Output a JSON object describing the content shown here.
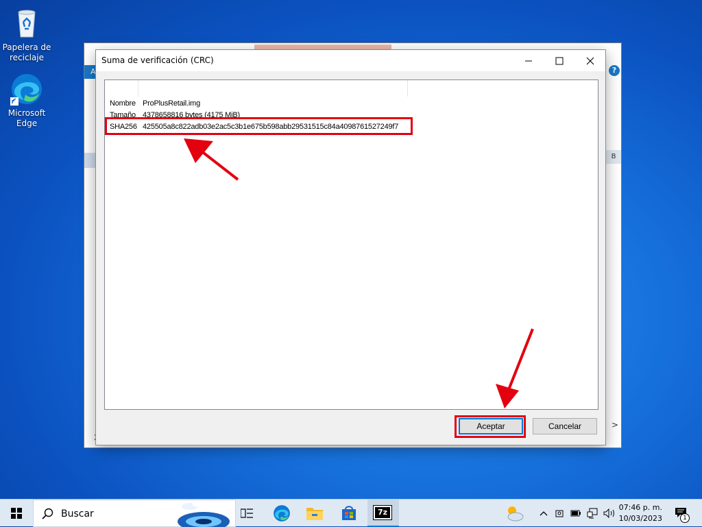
{
  "desktop": {
    "icons": [
      {
        "label": "Papelera de reciclaje"
      },
      {
        "label": "Microsoft Edge"
      }
    ]
  },
  "background_window": {
    "ribbon_letter": "A",
    "help_glyph": "?",
    "status_fragment": "2",
    "right_fragment": "B",
    "right_chevron": ">"
  },
  "dialog": {
    "title": "Suma de verificación (CRC)",
    "rows": [
      {
        "key": "Nombre",
        "value": "ProPlusRetail.img"
      },
      {
        "key": "Tamaño",
        "value": "4378658816 bytes (4175 MiB)"
      },
      {
        "key": "SHA256",
        "value": "425505a8c822adb03e2ac5c3b1e675b598abb29531515c84a4098761527249f7"
      }
    ],
    "ok_label": "Aceptar",
    "cancel_label": "Cancelar"
  },
  "annotation": {
    "color": "#e3000f"
  },
  "taskbar": {
    "search_placeholder": "Buscar",
    "app_7zip_label": "7z",
    "time": "07:46 p. m.",
    "date": "10/03/2023",
    "notification_count": "1"
  },
  "colors": {
    "accent": "#0078d7",
    "highlight": "#e3000f"
  }
}
